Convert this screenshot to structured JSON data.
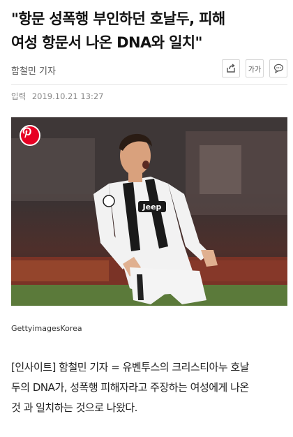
{
  "article": {
    "headline_line1": "\"항문 성폭행 부인하던 호날두, 피해",
    "headline_line2": "여성 항문서 나온 DNA와 일치\"",
    "reporter": "함철민 기자",
    "date_label": "입력",
    "date_value": "2019.10.21 13:27",
    "photo_caption": "GettyimagesKorea",
    "jersey_text": "Jeep",
    "body_line1": "[인사이트] 함철민 기자 = 유벤투스의 크리스티아누 호날",
    "body_line2": "두의 DNA가, 성폭행 피해자라고 주장하는 여성에게 나온",
    "body_line3": "것 과 일치하는 것으로 나왔다."
  },
  "toolbar": {
    "font_size_label": "가가",
    "icons": [
      "share-icon",
      "font-size-icon",
      "comment-icon"
    ]
  },
  "overlay": {
    "icon": "pinterest-icon",
    "color": "#e60023"
  },
  "colors": {
    "headline": "#111111",
    "meta": "#888888",
    "body": "#222222"
  }
}
